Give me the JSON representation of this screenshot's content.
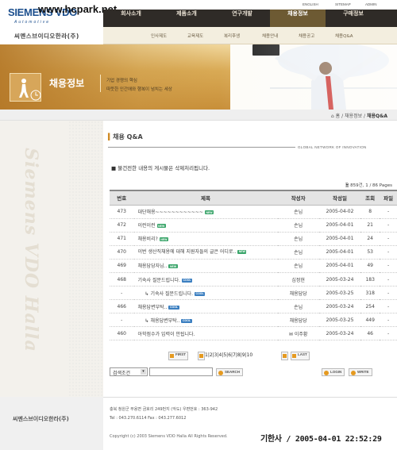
{
  "header": {
    "logo": "SIEMENS VDO",
    "logo_sub": "Automotive",
    "watermark": "www.hcpark.net",
    "company_kr": "씨멘스브이디오한라(주)",
    "util_links": [
      "ENGLISH",
      "SITEMAP",
      "ADMIN"
    ],
    "menu": [
      "회사소개",
      "제품소개",
      "연구개발",
      "채용정보",
      "구매정보"
    ],
    "submenu": [
      "인사제도",
      "교육제도",
      "복리후생",
      "채용안내",
      "채용공고",
      "채용Q&A"
    ]
  },
  "banner": {
    "title": "채용정보",
    "line1": "기업 경쟁의 핵심",
    "line2": "따뜻한 인간애와 행복이 넘치는 세상"
  },
  "breadcrumb": {
    "home": "홈",
    "section": "채용정보",
    "current": "채용Q&A"
  },
  "side": {
    "word": "Siemens VDO Halla"
  },
  "board": {
    "title": "채용 Q&A",
    "tagline": "GLOBAL NETWORK OF INNOVATION",
    "notice": "불건전한 내용의 게시물은 삭제처리됩니다.",
    "count": "859건, 1 / 86 Pages",
    "headers": [
      "번호",
      "제목",
      "작성자",
      "작성일",
      "조회",
      "파일"
    ],
    "rows": [
      {
        "no": "473",
        "subject": "대단해용~~~~~~~~~~~~",
        "reply": false,
        "badge": "NEW",
        "author": "손님",
        "date": "2005-04-02",
        "views": "8",
        "file": "-"
      },
      {
        "no": "472",
        "subject": "이런이런",
        "reply": false,
        "badge": "NEW",
        "author": "손님",
        "date": "2005-04-01",
        "views": "21",
        "file": "-"
      },
      {
        "no": "471",
        "subject": "채용비리?",
        "reply": false,
        "badge": "NEW",
        "author": "손님",
        "date": "2005-04-01",
        "views": "24",
        "file": "-"
      },
      {
        "no": "470",
        "subject": "이번 생산직채용에 대해 지원자들의 글은 어디로..",
        "reply": false,
        "badge": "NEW",
        "author": "손님",
        "date": "2005-04-01",
        "views": "53",
        "file": "-"
      },
      {
        "no": "469",
        "subject": "채용담당자님..",
        "reply": false,
        "badge": "NEW",
        "author": "손님",
        "date": "2005-04-01",
        "views": "49",
        "file": "-"
      },
      {
        "no": "468",
        "subject": "기숙사 질문드립니다.",
        "reply": false,
        "badge": "COOL",
        "author": "심정현",
        "date": "2005-03-24",
        "views": "183",
        "file": "-"
      },
      {
        "no": "-",
        "subject": "기숙사 질문드립니다.",
        "reply": true,
        "badge": "COOL",
        "author": "채용담당",
        "date": "2005-03-25",
        "views": "318",
        "file": "-"
      },
      {
        "no": "466",
        "subject": "채용답변부탁..",
        "reply": false,
        "badge": "COOL",
        "author": "손님",
        "date": "2005-03-24",
        "views": "254",
        "file": "-"
      },
      {
        "no": "-",
        "subject": "채용답변부탁..",
        "reply": true,
        "badge": "COOL",
        "author": "채용담당",
        "date": "2005-03-25",
        "views": "449",
        "file": "-"
      },
      {
        "no": "460",
        "subject": "아학점수가 입력이 안됩니다.",
        "reply": false,
        "badge": "",
        "author": "이주황",
        "date": "2005-03-24",
        "views": "46",
        "file": "-"
      }
    ],
    "pager": {
      "first": "FIRST",
      "last": "LAST",
      "pages": "1|2|3|4|5|6|7|8|9|10"
    },
    "search_select": "검색조건",
    "search_button": "SEARCH",
    "login_button": "LOGIN",
    "write_button": "WRITE"
  },
  "footer": {
    "name": "씨멘스브이디오한라(주)",
    "address": "충북 청원군 부용면 금호리 249번지 (악도) 우편번호 : 363-942",
    "tel": "Tel : 043.270.6114 Fax : 043.277.6012",
    "copyright": "Copyright (c) 2003 Siemens VDO Halla All Rights Reserved.",
    "stamp": "기한사 / 2005-04-01 22:52:29"
  },
  "colors": {
    "nav_dark": "#2f2b27",
    "nav_active": "#6d5a33",
    "banner_gold": "#d9aa55",
    "badge_new": "#3aa56a",
    "badge_cool": "#3a7ec0"
  }
}
